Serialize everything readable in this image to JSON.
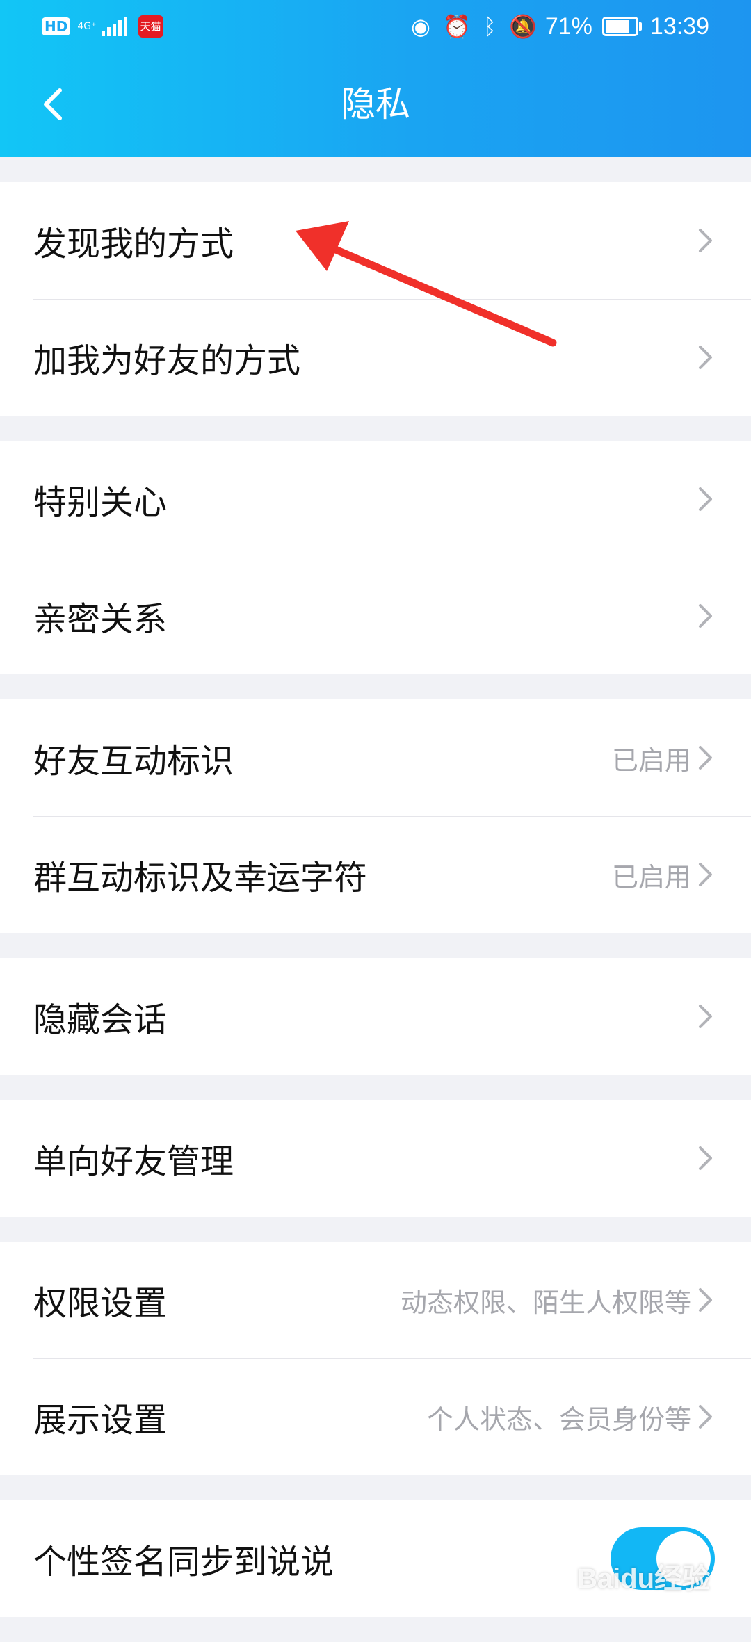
{
  "status_bar": {
    "hd": "HD",
    "network": "4G⁺",
    "carrier_app": "天猫",
    "battery_text": "71%",
    "battery_level": 0.71,
    "time": "13:39"
  },
  "header": {
    "title": "隐私",
    "back_icon": "chevron-left-icon"
  },
  "groups": [
    {
      "rows": [
        {
          "label": "发现我的方式",
          "value": ""
        },
        {
          "label": "加我为好友的方式",
          "value": ""
        }
      ]
    },
    {
      "rows": [
        {
          "label": "特别关心",
          "value": ""
        },
        {
          "label": "亲密关系",
          "value": ""
        }
      ]
    },
    {
      "rows": [
        {
          "label": "好友互动标识",
          "value": "已启用"
        },
        {
          "label": "群互动标识及幸运字符",
          "value": "已启用"
        }
      ]
    },
    {
      "rows": [
        {
          "label": "隐藏会话",
          "value": ""
        }
      ]
    },
    {
      "rows": [
        {
          "label": "单向好友管理",
          "value": ""
        }
      ]
    },
    {
      "rows": [
        {
          "label": "权限设置",
          "value": "动态权限、陌生人权限等"
        },
        {
          "label": "展示设置",
          "value": "个人状态、会员身份等"
        }
      ]
    },
    {
      "rows": [
        {
          "label": "个性签名同步到说说",
          "toggle": true
        }
      ]
    }
  ],
  "annotation": {
    "color": "#f0302a"
  },
  "watermark": "Baidu经验",
  "colors": {
    "accent": "#12b7f5",
    "header_start": "#12c6f6",
    "header_end": "#1d95f0"
  }
}
